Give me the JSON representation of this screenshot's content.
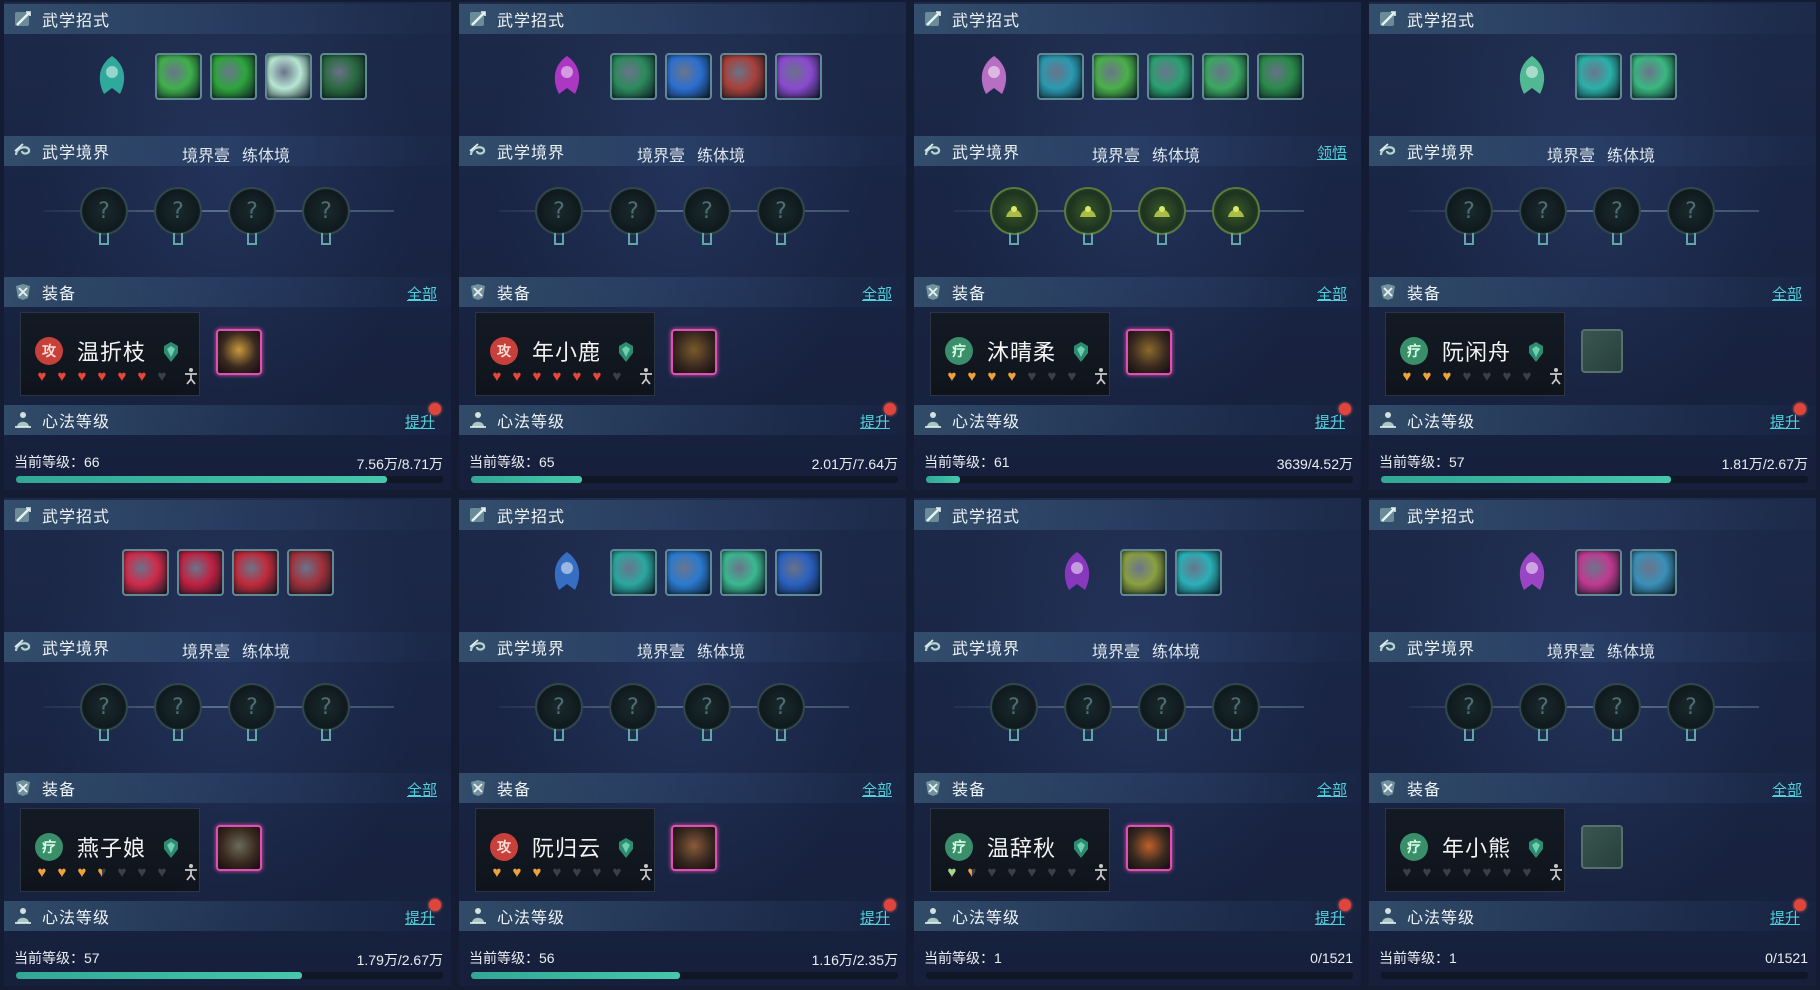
{
  "labels": {
    "skills_title": "武学招式",
    "realm_title": "武学境界",
    "equip_title": "装备",
    "equip_all": "全部",
    "heart_title": "心法等级",
    "heart_upgrade": "提升"
  },
  "colors": {
    "accent_cyan": "#4fd1dd",
    "xp_fill": "#3fbea4",
    "red_dot": "#e0443a",
    "heart_red": "#e8463a",
    "heart_orange": "#f0a23a",
    "heart_green": "#a8d88a",
    "heart_empty": "#3b3f46",
    "tag_attack": "#c8403a",
    "tag_support": "#3a8f6a"
  },
  "panels": [
    {
      "realm_level": "境界壹",
      "realm_stage": "练体境",
      "realm_extra": "",
      "main_skill": {
        "icon": "jade-spirit-icon",
        "color": "#32c0a8"
      },
      "skills": [
        {
          "icon": "green-slash-icon",
          "color": "#3fb04a"
        },
        {
          "icon": "green-claw-icon",
          "color": "#2ea53c"
        },
        {
          "icon": "white-ring-icon",
          "color": "#b7e6d2"
        },
        {
          "icon": "yin-yang-icon",
          "color": "#2a6a40"
        }
      ],
      "nodes": [
        "?",
        "?",
        "?",
        "?"
      ],
      "character": {
        "name": "温折枝",
        "tag": "攻",
        "tag_type": "attack",
        "hearts": [
          "red",
          "red",
          "red",
          "red",
          "red",
          "red",
          "empty"
        ]
      },
      "gear": {
        "type": "epic",
        "icon": "golden-armor-icon",
        "color": "#c99a3c"
      },
      "level_text": "当前等级：66",
      "xp_text": "7.56万/8.71万",
      "progress": 0.87
    },
    {
      "realm_level": "境界壹",
      "realm_stage": "练体境",
      "realm_extra": "",
      "main_skill": {
        "icon": "purple-orb-icon",
        "color": "#c43ad8"
      },
      "skills": [
        {
          "icon": "green-burst-icon",
          "color": "#2c8a5c"
        },
        {
          "icon": "blue-wave-icon",
          "color": "#2b6fd0"
        },
        {
          "icon": "red-scales-icon",
          "color": "#a8403a"
        },
        {
          "icon": "purple-strike-icon",
          "color": "#8a4ad0"
        }
      ],
      "nodes": [
        "?",
        "?",
        "?",
        "?"
      ],
      "character": {
        "name": "年小鹿",
        "tag": "攻",
        "tag_type": "attack",
        "hearts": [
          "red",
          "red",
          "red",
          "red",
          "red",
          "red",
          "empty"
        ]
      },
      "gear": {
        "type": "epic",
        "icon": "dark-armor-icon",
        "color": "#7a5a2a"
      },
      "level_text": "当前等级：65",
      "xp_text": "2.01万/7.64万",
      "progress": 0.26
    },
    {
      "realm_level": "境界壹",
      "realm_stage": "练体境",
      "realm_extra": "领悟",
      "main_skill": {
        "icon": "pink-figure-icon",
        "color": "#d47ad8"
      },
      "skills": [
        {
          "icon": "teal-swirl-icon",
          "color": "#2a9ab0"
        },
        {
          "icon": "green-wind-icon",
          "color": "#4ab04a"
        },
        {
          "icon": "green-vortex-icon",
          "color": "#2aa070"
        },
        {
          "icon": "leaf-icon",
          "color": "#3aa860"
        },
        {
          "icon": "green-dragon-icon",
          "color": "#2a8a4a"
        }
      ],
      "nodes": [
        "leaf",
        "moon",
        "lotus",
        "crown"
      ],
      "character": {
        "name": "沐晴柔",
        "tag": "疗",
        "tag_type": "support",
        "hearts": [
          "orange",
          "orange",
          "orange",
          "orange",
          "empty",
          "empty",
          "empty"
        ]
      },
      "gear": {
        "type": "epic",
        "icon": "bronze-armor-icon",
        "color": "#8a6a2a"
      },
      "level_text": "当前等级：61",
      "xp_text": "3639/4.52万",
      "progress": 0.08
    },
    {
      "realm_level": "境界壹",
      "realm_stage": "练体境",
      "realm_extra": "",
      "main_skill": {
        "icon": "green-sprout-icon",
        "color": "#5ad0a0"
      },
      "skills": [
        {
          "icon": "teal-bloom-icon",
          "color": "#2ab0a8"
        },
        {
          "icon": "daisy-icon",
          "color": "#3ab880"
        }
      ],
      "nodes": [
        "?",
        "?",
        "?",
        "?"
      ],
      "character": {
        "name": "阮闲舟",
        "tag": "疗",
        "tag_type": "support",
        "hearts": [
          "orange",
          "orange",
          "orange",
          "empty",
          "empty",
          "empty",
          "empty"
        ]
      },
      "gear": {
        "type": "empty",
        "icon": "cloth-icon",
        "color": "#3a5550"
      },
      "level_text": "当前等级：57",
      "xp_text": "1.81万/2.67万",
      "progress": 0.68
    },
    {
      "realm_level": "境界壹",
      "realm_stage": "练体境",
      "realm_extra": "",
      "main_skill": null,
      "skills": [
        {
          "icon": "red-slash-icon",
          "color": "#d02a4a"
        },
        {
          "icon": "red-double-slash-icon",
          "color": "#c02040"
        },
        {
          "icon": "rose-icon",
          "color": "#c02a3a"
        },
        {
          "icon": "red-warrior-icon",
          "color": "#a0303a"
        }
      ],
      "nodes": [
        "?",
        "?",
        "?",
        "?"
      ],
      "character": {
        "name": "燕子娘",
        "tag": "疗",
        "tag_type": "support",
        "hearts": [
          "orange",
          "orange",
          "orange",
          "half",
          "empty",
          "empty",
          "empty"
        ]
      },
      "gear": {
        "type": "epic",
        "icon": "steel-armor-icon",
        "color": "#6a6a5a"
      },
      "level_text": "当前等级：57",
      "xp_text": "1.79万/2.67万",
      "progress": 0.67
    },
    {
      "realm_level": "境界壹",
      "realm_stage": "练体境",
      "realm_extra": "",
      "main_skill": {
        "icon": "blue-flame-icon",
        "color": "#3a7ad8"
      },
      "skills": [
        {
          "icon": "teal-stream-icon",
          "color": "#2aa8a0"
        },
        {
          "icon": "blue-spiral-icon",
          "color": "#2a7ad0"
        },
        {
          "icon": "green-spark-icon",
          "color": "#3ab890"
        },
        {
          "icon": "blue-crescent-icon",
          "color": "#2a60c0"
        }
      ],
      "nodes": [
        "?",
        "?",
        "?",
        "?"
      ],
      "character": {
        "name": "阮归云",
        "tag": "攻",
        "tag_type": "attack",
        "hearts": [
          "orange",
          "orange",
          "orange",
          "empty",
          "empty",
          "empty",
          "empty"
        ]
      },
      "gear": {
        "type": "epic",
        "icon": "leather-armor-icon",
        "color": "#8a5a3a"
      },
      "level_text": "当前等级：56",
      "xp_text": "1.16万/2.35万",
      "progress": 0.49
    },
    {
      "realm_level": "境界壹",
      "realm_stage": "练体境",
      "realm_extra": "",
      "main_skill": {
        "icon": "violet-mage-icon",
        "color": "#9a3ad0"
      },
      "skills": [
        {
          "icon": "golden-hands-icon",
          "color": "#8aa040"
        },
        {
          "icon": "cyan-sun-icon",
          "color": "#2ab0b8"
        }
      ],
      "nodes": [
        "?",
        "?",
        "?",
        "?"
      ],
      "character": {
        "name": "温辞秋",
        "tag": "疗",
        "tag_type": "support",
        "hearts": [
          "green",
          "half",
          "empty",
          "empty",
          "empty",
          "empty",
          "empty"
        ]
      },
      "gear": {
        "type": "epic",
        "icon": "orange-armor-icon",
        "color": "#c0602a"
      },
      "level_text": "当前等级：1",
      "xp_text": "0/1521",
      "progress": 0
    },
    {
      "realm_level": "境界壹",
      "realm_stage": "练体境",
      "realm_extra": "",
      "main_skill": {
        "icon": "violet-crystal-icon",
        "color": "#b04ad8"
      },
      "skills": [
        {
          "icon": "magenta-beast-icon",
          "color": "#c03a90"
        },
        {
          "icon": "ice-fang-icon",
          "color": "#3a90b8"
        }
      ],
      "nodes": [
        "?",
        "?",
        "?",
        "?"
      ],
      "character": {
        "name": "年小熊",
        "tag": "疗",
        "tag_type": "support",
        "hearts": [
          "empty",
          "empty",
          "empty",
          "empty",
          "empty",
          "empty",
          "empty"
        ]
      },
      "gear": {
        "type": "empty",
        "icon": "cloth-icon",
        "color": "#3a5550"
      },
      "level_text": "当前等级：1",
      "xp_text": "0/1521",
      "progress": 0
    }
  ]
}
